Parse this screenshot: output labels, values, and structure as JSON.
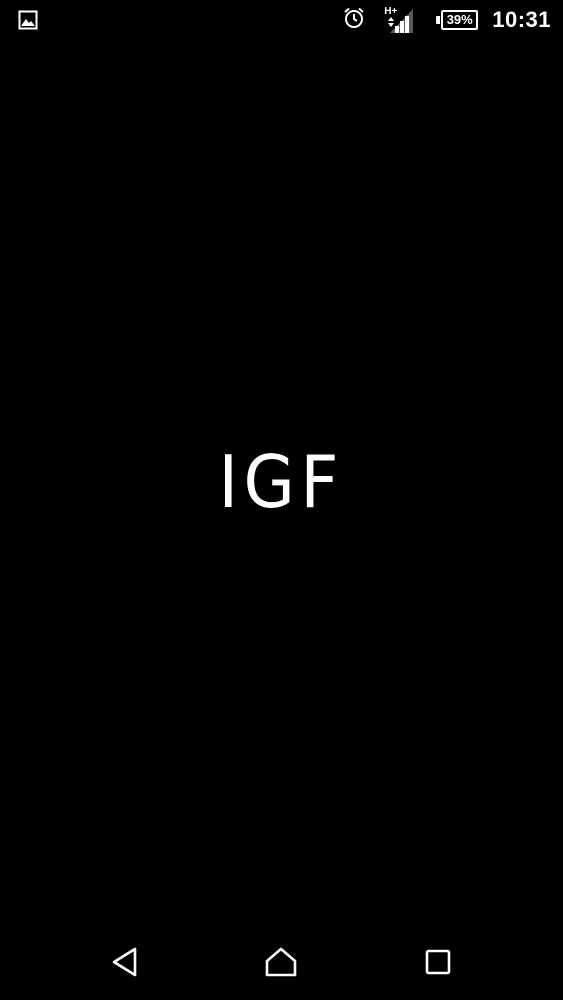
{
  "status_bar": {
    "notification_icon": "image-icon",
    "alarm_icon": "alarm-clock-icon",
    "network_type": "H+",
    "signal_icon": "cell-signal-icon",
    "battery_percent": "39%",
    "time": "10:31"
  },
  "splash": {
    "logo_text": "IGF"
  },
  "navigation": {
    "back_icon": "back-triangle-icon",
    "home_icon": "home-icon",
    "recents_icon": "recents-square-icon"
  },
  "colors": {
    "background": "#000000",
    "foreground": "#ffffff"
  }
}
